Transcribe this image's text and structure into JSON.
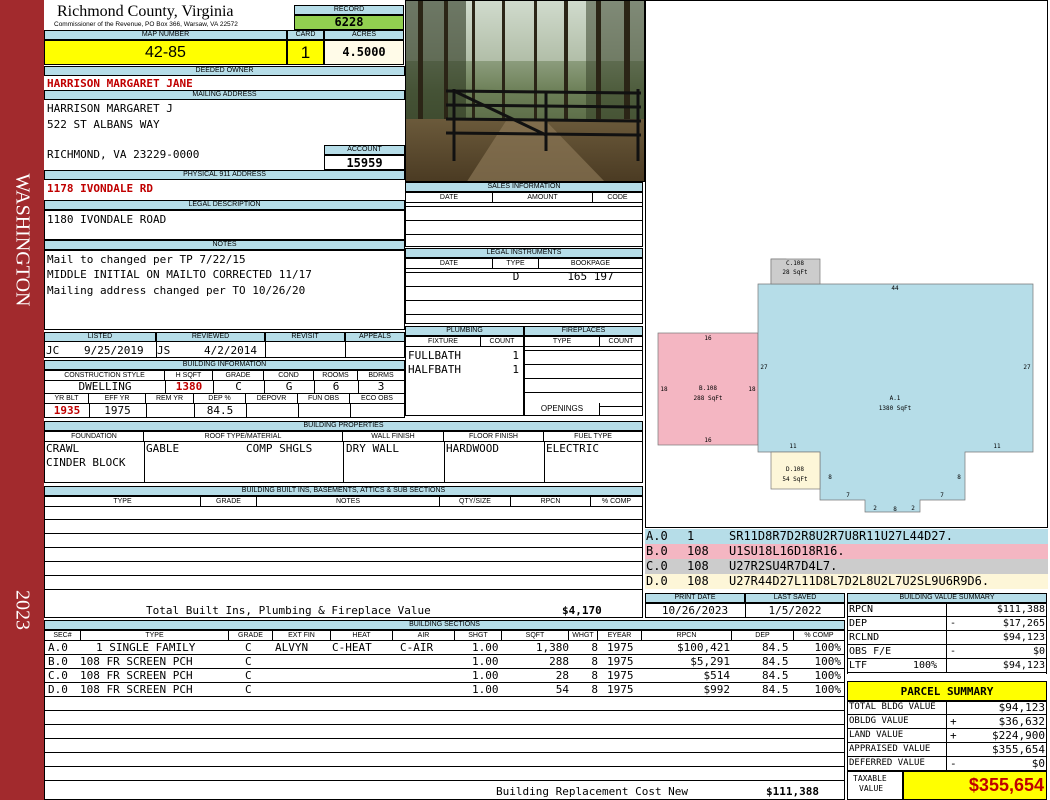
{
  "sidebar": {
    "district": "WASHINGTON",
    "year": "2023"
  },
  "header": {
    "county": "Richmond County, Virginia",
    "office": "Commissioner of the Revenue, PO Box 366, Warsaw, VA 22572",
    "record_label": "RECORD",
    "record": "6228",
    "map_label": "MAP NUMBER",
    "map": "42-85",
    "card_label": "CARD",
    "card": "1",
    "acres_label": "ACRES",
    "acres": "4.5000"
  },
  "owner": {
    "label": "DEEDED OWNER",
    "name": "HARRISON MARGARET JANE",
    "mailing_label": "MAILING ADDRESS",
    "mail_line1": "HARRISON MARGARET J",
    "mail_line2": "522 ST ALBANS WAY",
    "mail_line3": "RICHMOND, VA 23229-0000",
    "account_label": "ACCOUNT",
    "account": "15959",
    "physical_label": "PHYSICAL 911 ADDRESS",
    "physical": "1178 IVONDALE RD",
    "legal_label": "LEGAL DESCRIPTION",
    "legal": "1180 IVONDALE ROAD"
  },
  "notes": {
    "label": "NOTES",
    "lines": [
      "Mail to changed per TP 7/22/15",
      "MIDDLE INITIAL ON MAILTO CORRECTED 11/17",
      "Mailing address changed per TO 10/26/20"
    ]
  },
  "sales": {
    "label": "SALES INFORMATION",
    "cols": [
      "DATE",
      "AMOUNT",
      "CODE"
    ]
  },
  "legal_instruments": {
    "label": "LEGAL INSTRUMENTS",
    "cols": [
      "DATE",
      "TYPE",
      "BOOKPAGE"
    ],
    "type": "D",
    "bookpage": "165 197"
  },
  "plumbing": {
    "label": "PLUMBING",
    "cols": [
      "FIXTURE",
      "COUNT"
    ],
    "rows": [
      {
        "fixture": "FULLBATH",
        "count": "1"
      },
      {
        "fixture": "HALFBATH",
        "count": "1"
      }
    ]
  },
  "fireplaces": {
    "label": "FIREPLACES",
    "cols": [
      "TYPE",
      "COUNT"
    ],
    "openings": "OPENINGS"
  },
  "review": {
    "cols": [
      "LISTED",
      "REVIEWED",
      "REVISIT",
      "APPEALS"
    ],
    "listed_by": "JC",
    "listed_date": "9/25/2019",
    "reviewed_by": "JS",
    "reviewed_date": "4/2/2014"
  },
  "building_info": {
    "label": "BUILDING INFORMATION",
    "cols1": [
      "CONSTRUCTION STYLE",
      "H SQFT",
      "GRADE",
      "COND",
      "ROOMS",
      "BDRMS"
    ],
    "style": "DWELLING",
    "hsqft": "1380",
    "grade": "C",
    "cond": "G",
    "rooms": "6",
    "bdrms": "3",
    "cols2": [
      "YR BLT",
      "EFF YR",
      "REM YR",
      "DEP %",
      "DEPOVR",
      "FUN OBS",
      "ECO OBS"
    ],
    "yrblt": "1935",
    "effyr": "1975",
    "dep": "84.5"
  },
  "building_props": {
    "label": "BUILDING PROPERTIES",
    "cols": [
      "FOUNDATION",
      "ROOF TYPE/MATERIAL",
      "WALL FINISH",
      "FLOOR FINISH",
      "FUEL TYPE"
    ],
    "foundation1": "CRAWL",
    "foundation2": "CINDER BLOCK",
    "roof_type": "GABLE",
    "roof_mat": "COMP SHGLS",
    "wall": "DRY WALL",
    "floor": "HARDWOOD",
    "fuel": "ELECTRIC"
  },
  "builtins": {
    "label": "BUILDING BUILT INS, BASEMENTS, ATTICS & SUB SECTIONS",
    "cols": [
      "TYPE",
      "GRADE",
      "NOTES",
      "QTY/SIZE",
      "RPCN",
      "% COMP"
    ],
    "total_label": "Total Built Ins, Plumbing & Fireplace Value",
    "total": "$4,170"
  },
  "sketch": {
    "c": {
      "id": "C.108",
      "area": "28 SqFt"
    },
    "b": {
      "id": "B.108",
      "area": "288 SqFt"
    },
    "a": {
      "id": "A.1",
      "area": "1380 SqFt"
    },
    "d": {
      "id": "D.108",
      "area": "54 SqFt"
    },
    "dims": {
      "top": "44",
      "left27": "27",
      "right27": "27",
      "b16top": "16",
      "b16bot": "16",
      "b18l": "18",
      "b18r": "18",
      "n11l": "11",
      "n11r": "11",
      "n8l": "8",
      "n8r": "8",
      "n7l": "7",
      "n7r": "7",
      "n2l": "2",
      "n2r": "2",
      "n8b": "8"
    }
  },
  "segments": [
    {
      "id": "A.0",
      "type": "1",
      "desc": "SR11D8R7D2R8U2R7U8R11U27L44D27."
    },
    {
      "id": "B.0",
      "type": "108",
      "desc": "U1SU18L16D18R16."
    },
    {
      "id": "C.0",
      "type": "108",
      "desc": "U27R2SU4R7D4L7."
    },
    {
      "id": "D.0",
      "type": "108",
      "desc": "U27R44D27L11D8L7D2L8U2L7U2SL9U6R9D6."
    }
  ],
  "print": {
    "print_label": "PRINT DATE",
    "print_date": "10/26/2023",
    "saved_label": "LAST SAVED",
    "saved_date": "1/5/2022"
  },
  "sections": {
    "label": "BUILDING SECTIONS",
    "cols": [
      "SEC#",
      "TYPE",
      "GRADE",
      "EXT FIN",
      "HEAT",
      "AIR",
      "SHGT",
      "SQFT",
      "WHGT",
      "EYEAR",
      "RPCN",
      "DEP",
      "% COMP"
    ],
    "rows": [
      {
        "sec": "A.0",
        "type": "1 SINGLE FAMILY",
        "grade": "C",
        "ext": "ALVYN",
        "heat": "C-HEAT",
        "air": "C-AIR",
        "shgt": "1.00",
        "sqft": "1,380",
        "whgt": "8",
        "eyear": "1975",
        "rpcn": "$100,421",
        "dep": "84.5",
        "comp": "100%"
      },
      {
        "sec": "B.0",
        "type": "108 FR SCREEN PCH",
        "grade": "C",
        "ext": "",
        "heat": "",
        "air": "",
        "shgt": "1.00",
        "sqft": "288",
        "whgt": "8",
        "eyear": "1975",
        "rpcn": "$5,291",
        "dep": "84.5",
        "comp": "100%"
      },
      {
        "sec": "C.0",
        "type": "108 FR SCREEN PCH",
        "grade": "C",
        "ext": "",
        "heat": "",
        "air": "",
        "shgt": "1.00",
        "sqft": "28",
        "whgt": "8",
        "eyear": "1975",
        "rpcn": "$514",
        "dep": "84.5",
        "comp": "100%"
      },
      {
        "sec": "D.0",
        "type": "108 FR SCREEN PCH",
        "grade": "C",
        "ext": "",
        "heat": "",
        "air": "",
        "shgt": "1.00",
        "sqft": "54",
        "whgt": "8",
        "eyear": "1975",
        "rpcn": "$992",
        "dep": "84.5",
        "comp": "100%"
      }
    ],
    "replacement_label": "Building Replacement Cost New",
    "replacement": "$111,388"
  },
  "value_summary": {
    "label": "BUILDING VALUE SUMMARY",
    "rows": [
      {
        "label": "RPCN",
        "sign": "",
        "pct": "",
        "value": "$111,388"
      },
      {
        "label": "DEP",
        "sign": "-",
        "pct": "",
        "value": "$17,265"
      },
      {
        "label": "RCLND",
        "sign": "",
        "pct": "",
        "value": "$94,123"
      },
      {
        "label": "OBS F/E",
        "sign": "-",
        "pct": "",
        "value": "$0"
      },
      {
        "label": "LTF",
        "sign": "",
        "pct": "100%",
        "value": "$94,123"
      }
    ]
  },
  "parcel": {
    "label": "PARCEL SUMMARY",
    "rows": [
      {
        "label": "TOTAL BLDG VALUE",
        "sign": "",
        "value": "$94,123"
      },
      {
        "label": "OBLDG VALUE",
        "sign": "+",
        "value": "$36,632"
      },
      {
        "label": "LAND VALUE",
        "sign": "+",
        "value": "$224,900"
      },
      {
        "label": "APPRAISED VALUE",
        "sign": "",
        "value": "$355,654"
      },
      {
        "label": "DEFERRED VALUE",
        "sign": "-",
        "value": "$0"
      }
    ],
    "taxable_label1": "TAXABLE",
    "taxable_label2": "VALUE",
    "taxable": "$355,654"
  },
  "colors": {
    "sidebar": "#a22a2d",
    "header_blue": "#b6dde8",
    "yellow": "#ffff00",
    "record_green": "#92d050",
    "b_pink": "#f4b6c2",
    "a_blue": "#b6dde8",
    "c_gray": "#cccccc",
    "d_cream": "#fdf6d8",
    "red_text": "#c00000"
  }
}
